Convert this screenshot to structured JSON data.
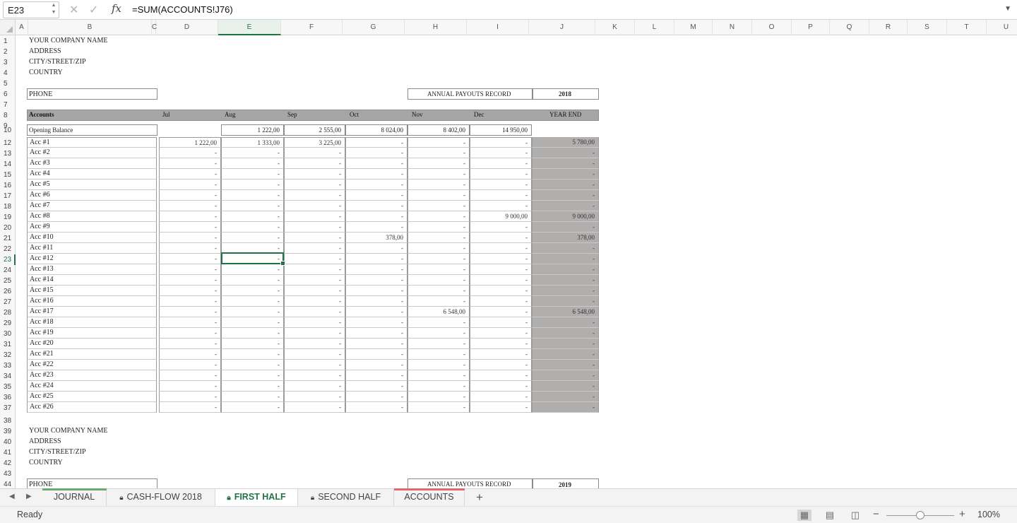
{
  "formula_bar": {
    "cell_ref": "E23",
    "formula": "=SUM(ACCOUNTS!J76)",
    "spin_icon": "stepper-icon",
    "cancel_icon": "cancel-x-icon",
    "enter_icon": "checkmark-icon",
    "fx_label": "fx",
    "dropdown_icon": "chevron-down-icon"
  },
  "grid": {
    "column_letters": [
      "A",
      "B",
      "C",
      "D",
      "E",
      "F",
      "G",
      "H",
      "I",
      "J",
      "K",
      "L",
      "M",
      "N",
      "O",
      "P",
      "Q",
      "R",
      "S",
      "T",
      "U"
    ],
    "row_numbers": [
      "1",
      "2",
      "3",
      "4",
      "5",
      "6",
      "7",
      "8",
      "9",
      "10",
      "12",
      "13",
      "14",
      "15",
      "16",
      "17",
      "18",
      "19",
      "20",
      "21",
      "22",
      "23",
      "24",
      "25",
      "26",
      "27",
      "28",
      "29",
      "30",
      "31",
      "32",
      "33",
      "34",
      "35",
      "36",
      "37",
      "38",
      "39",
      "40",
      "41",
      "42",
      "43",
      "44"
    ],
    "active_column": "E",
    "active_row": "23"
  },
  "company": {
    "name": "YOUR COMPANY NAME",
    "address": "ADDRESS",
    "city": "CITY/STREET/ZIP",
    "country": "COUNTRY",
    "phone": "PHONE"
  },
  "record": {
    "label": "ANNUAL PAYOUTS RECORD",
    "year": "2018",
    "year_second": "2019"
  },
  "table": {
    "headers": [
      "Accounts",
      "Jul",
      "Aug",
      "Sep",
      "Oct",
      "Nov",
      "Dec",
      "YEAR END"
    ],
    "opening_balance": {
      "label": "Opening Balance",
      "values": [
        "",
        "1 222,00",
        "2 555,00",
        "8 024,00",
        "8 402,00",
        "14 950,00"
      ]
    },
    "accounts": [
      {
        "name": "Acc #1",
        "values": [
          "1 222,00",
          "1 333,00",
          "3 225,00",
          "-",
          "-",
          "-"
        ],
        "year_end": "5 780,00"
      },
      {
        "name": "Acc #2",
        "values": [
          "-",
          "-",
          "-",
          "-",
          "-",
          "-"
        ],
        "year_end": "-"
      },
      {
        "name": "Acc #3",
        "values": [
          "-",
          "-",
          "-",
          "-",
          "-",
          "-"
        ],
        "year_end": "-"
      },
      {
        "name": "Acc #4",
        "values": [
          "-",
          "-",
          "-",
          "-",
          "-",
          "-"
        ],
        "year_end": "-"
      },
      {
        "name": "Acc #5",
        "values": [
          "-",
          "-",
          "-",
          "-",
          "-",
          "-"
        ],
        "year_end": "-"
      },
      {
        "name": "Acc #6",
        "values": [
          "-",
          "-",
          "-",
          "-",
          "-",
          "-"
        ],
        "year_end": "-"
      },
      {
        "name": "Acc #7",
        "values": [
          "-",
          "-",
          "-",
          "-",
          "-",
          "-"
        ],
        "year_end": "-"
      },
      {
        "name": "Acc #8",
        "values": [
          "-",
          "-",
          "-",
          "-",
          "-",
          "9 000,00"
        ],
        "year_end": "9 000,00"
      },
      {
        "name": "Acc #9",
        "values": [
          "-",
          "-",
          "-",
          "-",
          "-",
          "-"
        ],
        "year_end": "-"
      },
      {
        "name": "Acc #10",
        "values": [
          "-",
          "-",
          "-",
          "378,00",
          "-",
          "-"
        ],
        "year_end": "378,00"
      },
      {
        "name": "Acc #11",
        "values": [
          "-",
          "-",
          "-",
          "-",
          "-",
          "-"
        ],
        "year_end": "-"
      },
      {
        "name": "Acc #12",
        "values": [
          "-",
          "-",
          "-",
          "-",
          "-",
          "-"
        ],
        "year_end": "-"
      },
      {
        "name": "Acc #13",
        "values": [
          "-",
          "-",
          "-",
          "-",
          "-",
          "-"
        ],
        "year_end": "-"
      },
      {
        "name": "Acc #14",
        "values": [
          "-",
          "-",
          "-",
          "-",
          "-",
          "-"
        ],
        "year_end": "-"
      },
      {
        "name": "Acc #15",
        "values": [
          "-",
          "-",
          "-",
          "-",
          "-",
          "-"
        ],
        "year_end": "-"
      },
      {
        "name": "Acc #16",
        "values": [
          "-",
          "-",
          "-",
          "-",
          "-",
          "-"
        ],
        "year_end": "-"
      },
      {
        "name": "Acc #17",
        "values": [
          "-",
          "-",
          "-",
          "-",
          "6 548,00",
          "-"
        ],
        "year_end": "6 548,00"
      },
      {
        "name": "Acc #18",
        "values": [
          "-",
          "-",
          "-",
          "-",
          "-",
          "-"
        ],
        "year_end": "-"
      },
      {
        "name": "Acc #19",
        "values": [
          "-",
          "-",
          "-",
          "-",
          "-",
          "-"
        ],
        "year_end": "-"
      },
      {
        "name": "Acc #20",
        "values": [
          "-",
          "-",
          "-",
          "-",
          "-",
          "-"
        ],
        "year_end": "-"
      },
      {
        "name": "Acc #21",
        "values": [
          "-",
          "-",
          "-",
          "-",
          "-",
          "-"
        ],
        "year_end": "-"
      },
      {
        "name": "Acc #22",
        "values": [
          "-",
          "-",
          "-",
          "-",
          "-",
          "-"
        ],
        "year_end": "-"
      },
      {
        "name": "Acc #23",
        "values": [
          "-",
          "-",
          "-",
          "-",
          "-",
          "-"
        ],
        "year_end": "-"
      },
      {
        "name": "Acc #24",
        "values": [
          "-",
          "-",
          "-",
          "-",
          "-",
          "-"
        ],
        "year_end": "-"
      },
      {
        "name": "Acc #25",
        "values": [
          "-",
          "-",
          "-",
          "-",
          "-",
          "-"
        ],
        "year_end": "-"
      },
      {
        "name": "Acc #26",
        "values": [
          "-",
          "-",
          "-",
          "-",
          "-",
          "-"
        ],
        "year_end": "-"
      }
    ]
  },
  "tabs": {
    "items": [
      {
        "label": "JOURNAL",
        "locked": false,
        "active": false,
        "color": "#6aab72"
      },
      {
        "label": "CASH-FLOW 2018",
        "locked": true,
        "active": false,
        "color": ""
      },
      {
        "label": "FIRST HALF",
        "locked": true,
        "active": true,
        "color": ""
      },
      {
        "label": "SECOND HALF",
        "locked": true,
        "active": false,
        "color": ""
      },
      {
        "label": "ACCOUNTS",
        "locked": false,
        "active": false,
        "color": "#e06a6a"
      }
    ],
    "add_label": "+",
    "prev_icon": "scroll-left-icon",
    "next_icon": "scroll-right-icon",
    "lock_icon": "lock-icon"
  },
  "status": {
    "text": "Ready",
    "zoom": "100%",
    "zoom_minus": "−",
    "zoom_plus": "+",
    "views": [
      "normal-view-icon",
      "page-layout-icon",
      "page-break-icon"
    ]
  },
  "colors": {
    "accent": "#217346",
    "header_fill": "#a8a5a5",
    "year_end_fill": "#b1aeae"
  }
}
